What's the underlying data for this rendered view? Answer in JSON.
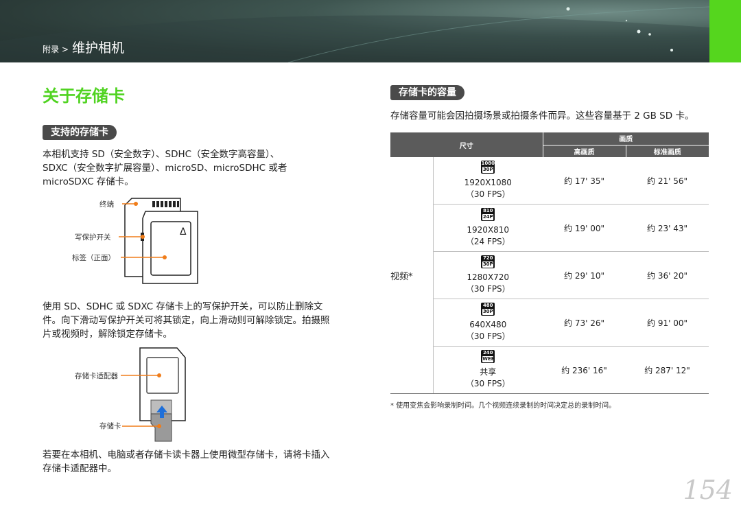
{
  "header": {
    "crumb_small": "附录 >",
    "crumb_big": "维护相机"
  },
  "page_title": "关于存储卡",
  "left": {
    "section_title": "支持的存储卡",
    "intro_lines": [
      "本相机支持 SD（安全数字）、SDHC（安全数字高容量）、",
      "SDXC（安全数字扩展容量）、microSD、microSDHC 或者",
      "microSDXC 存储卡。"
    ],
    "card_labels": {
      "terminal": "终端",
      "write_protect": "写保护开关",
      "label_front": "标签（正面）"
    },
    "card_mark": "Δ",
    "lock_lines": [
      "使用 SD、SDHC 或 SDXC 存储卡上的写保护开关，可以防止删除文",
      "件。向下滑动写保护开关可将其锁定，向上滑动则可解除锁定。拍摄照",
      "片或视频时，解除锁定存储卡。"
    ],
    "adapter_labels": {
      "adapter": "存储卡适配器",
      "card": "存储卡"
    },
    "micro_lines": [
      "若要在本相机、电脑或者存储卡读卡器上使用微型存储卡，请将卡插入",
      "存储卡适配器中。"
    ]
  },
  "right": {
    "section_title": "存储卡的容量",
    "desc": "存储容量可能会因拍摄场景或拍摄条件而异。这些容量基于 2 GB SD 卡。",
    "table": {
      "col_size": "尺寸",
      "col_quality": "画质",
      "col_high": "高画质",
      "col_std": "标准画质",
      "category": "视频*",
      "rows": [
        {
          "icon": [
            "1080",
            "30P"
          ],
          "size": "1920X1080",
          "fps": "（30 FPS）",
          "high": "约 17' 35\"",
          "std": "约 21' 56\""
        },
        {
          "icon": [
            "810",
            "24P"
          ],
          "size": "1920X810",
          "fps": "（24 FPS）",
          "high": "约 19' 00\"",
          "std": "约 23' 43\""
        },
        {
          "icon": [
            "720",
            "30P"
          ],
          "size": "1280X720",
          "fps": "（30 FPS）",
          "high": "约 29' 10\"",
          "std": "约 36' 20\""
        },
        {
          "icon": [
            "480",
            "30P"
          ],
          "size": "640X480",
          "fps": "（30 FPS）",
          "high": "约 73' 26\"",
          "std": "约 91' 00\""
        },
        {
          "icon": [
            "240",
            "WEB"
          ],
          "size": "共享",
          "fps": "（30 FPS）",
          "high": "约 236' 16\"",
          "std": "约 287' 12\""
        }
      ]
    },
    "footnote": "* 使用变焦会影响录制时间。几个视频连续录制的时间决定总的录制时间。"
  },
  "page_number": "154",
  "colors": {
    "accent_green": "#4fd320",
    "callout_orange": "#f07d1a",
    "arrow_blue": "#1e6fd9"
  }
}
